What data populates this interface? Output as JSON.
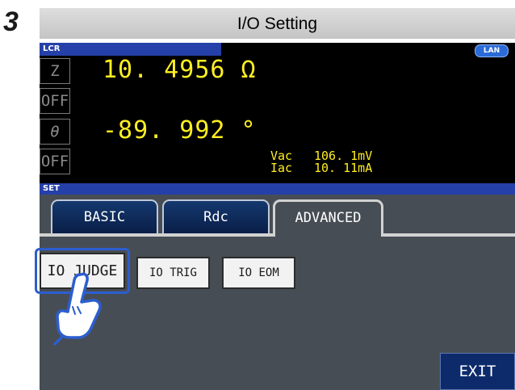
{
  "step": "3",
  "header": {
    "title": "I/O Setting"
  },
  "status": {
    "mode_label": "LCR",
    "lan_label": "LAN",
    "set_label": "SET"
  },
  "params": [
    {
      "name": "Z",
      "value": "10. 4956 Ω"
    },
    {
      "name": "OFF"
    },
    {
      "name": "θ",
      "value": "-89. 992 °"
    },
    {
      "name": "OFF"
    }
  ],
  "monitor": {
    "vac_label": "Vac",
    "vac_value": "106. 1mV",
    "iac_label": "Iac",
    "iac_value": "10. 11mA"
  },
  "tabs": [
    {
      "label": "BASIC"
    },
    {
      "label": "Rdc"
    },
    {
      "label": "ADVANCED"
    }
  ],
  "active_tab": "ADVANCED",
  "buttons": {
    "io_judge": "IO JUDGE",
    "io_trig": "IO TRIG",
    "io_eom": "IO EOM",
    "exit": "EXIT"
  },
  "icons": {
    "pointer": "hand-pointer-icon"
  },
  "colors": {
    "value_text": "#ffee22",
    "strip": "#2540a8",
    "tab_active_bg": "#474d54",
    "highlight": "#2c5ecf"
  }
}
